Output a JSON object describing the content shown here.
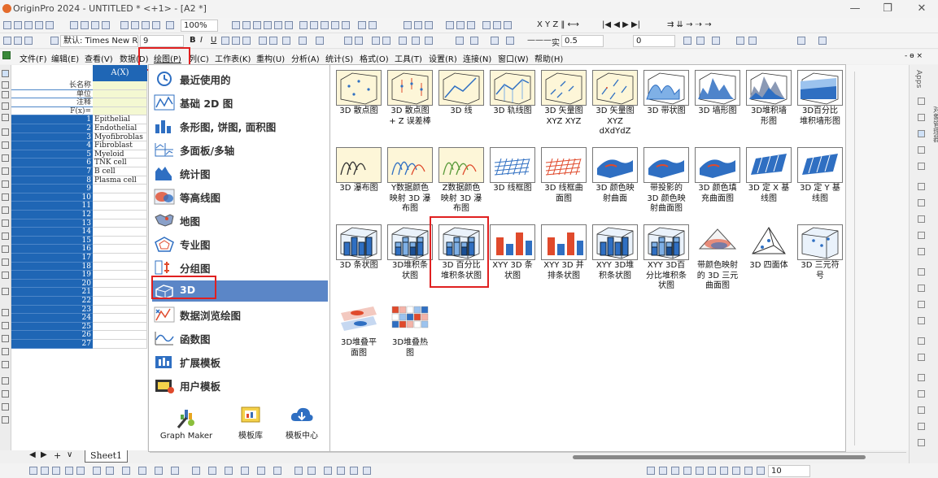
{
  "window": {
    "title": "OriginPro 2024 - UNTITLED * <+1> - [A2 *]",
    "minimize": "—",
    "restore": "❐",
    "close": "✕"
  },
  "toolbar": {
    "zoom": "100%",
    "font_name": "默认: Times New R",
    "font_size": "9",
    "bold": "B",
    "italic": "I",
    "underline": "U",
    "line_width_label": "实",
    "line_width": "0.5",
    "value2": "0",
    "pattern_value": "10"
  },
  "menubar": {
    "items": [
      "文件(F)",
      "编辑(E)",
      "查看(V)",
      "数据(D)",
      "绘图(P)",
      "列(C)",
      "工作表(K)",
      "重构(U)",
      "分析(A)",
      "统计(S)",
      "格式(O)",
      "工具(T)",
      "设置(R)",
      "连接(N)",
      "窗口(W)",
      "帮助(H)"
    ],
    "highlighted": "绘图(P)"
  },
  "sheet": {
    "column_header": "A(X)",
    "meta_rows": [
      "长名称",
      "单位",
      "注释",
      "F(x)="
    ],
    "rows": [
      {
        "n": "1",
        "v": "Epithelial"
      },
      {
        "n": "2",
        "v": "Endothelial"
      },
      {
        "n": "3",
        "v": "Myofibroblas"
      },
      {
        "n": "4",
        "v": "Fibroblast"
      },
      {
        "n": "5",
        "v": "Myeloid"
      },
      {
        "n": "6",
        "v": "TNK cell"
      },
      {
        "n": "7",
        "v": "B cell"
      },
      {
        "n": "8",
        "v": "Plasma cell"
      },
      {
        "n": "9",
        "v": ""
      },
      {
        "n": "10",
        "v": ""
      },
      {
        "n": "11",
        "v": ""
      },
      {
        "n": "12",
        "v": ""
      },
      {
        "n": "13",
        "v": ""
      },
      {
        "n": "14",
        "v": ""
      },
      {
        "n": "15",
        "v": ""
      },
      {
        "n": "16",
        "v": ""
      },
      {
        "n": "17",
        "v": ""
      },
      {
        "n": "18",
        "v": ""
      },
      {
        "n": "19",
        "v": ""
      },
      {
        "n": "20",
        "v": ""
      },
      {
        "n": "21",
        "v": ""
      },
      {
        "n": "22",
        "v": ""
      },
      {
        "n": "23",
        "v": ""
      },
      {
        "n": "24",
        "v": ""
      },
      {
        "n": "25",
        "v": ""
      },
      {
        "n": "26",
        "v": ""
      },
      {
        "n": "27",
        "v": ""
      }
    ],
    "tab_name": "Sheet1",
    "nav": [
      "◀",
      "▶",
      "+",
      "∨"
    ]
  },
  "plot_menu": {
    "categories": [
      {
        "label": "最近使用的",
        "icon": "recent-icon"
      },
      {
        "label": "基础 2D 图",
        "icon": "line-2d-icon"
      },
      {
        "label": "条形图, 饼图, 面积图",
        "icon": "bar-icon"
      },
      {
        "label": "多面板/多轴",
        "icon": "multipanel-icon"
      },
      {
        "label": "统计图",
        "icon": "histogram-icon"
      },
      {
        "label": "等高线图",
        "icon": "contour-icon"
      },
      {
        "label": "地图",
        "icon": "map-icon"
      },
      {
        "label": "专业图",
        "icon": "specialized-icon"
      },
      {
        "label": "分组图",
        "icon": "grouped-icon"
      },
      {
        "label": "3D",
        "icon": "cube-3d-icon"
      },
      {
        "label": "数据浏览绘图",
        "icon": "data-explore-icon"
      },
      {
        "label": "函数图",
        "icon": "function-icon"
      },
      {
        "label": "扩展模板",
        "icon": "extend-template-icon"
      },
      {
        "label": "用户模板",
        "icon": "user-template-icon"
      }
    ],
    "selected": "3D",
    "bottom_buttons": [
      "Graph Maker",
      "模板库",
      "模板中心"
    ]
  },
  "gallery": {
    "rows": [
      [
        "3D 散点图",
        "3D 散点图\n+ Z 误差棒",
        "3D 线",
        "3D 轨线图",
        "3D 矢量图\nXYZ XYZ",
        "3D 矢量图\nXYZ\ndXdYdZ",
        "3D 带状图",
        "3D 墙形图",
        "3D堆积墙\n形图",
        "3D百分比\n堆积墙形图"
      ],
      [
        "3D 瀑布图",
        "Y数据颜色\n映射 3D 瀑\n布图",
        "Z数据颜色\n映射 3D 瀑\n布图",
        "3D 线框图",
        "3D 线框曲\n面图",
        "3D 颜色映\n射曲面",
        "带投影的\n3D 颜色映\n射曲面图",
        "3D 颜色填\n充曲面图",
        "3D 定 X 基\n线图",
        "3D 定 Y 基\n线图"
      ],
      [
        "3D 条状图",
        "3D堆积条\n状图",
        "3D 百分比\n堆积条状图",
        "XYY 3D 条\n状图",
        "XYY 3D 并\n排条状图",
        "XYY 3D堆\n积条状图",
        "XYY 3D百\n分比堆积条\n状图",
        "带颜色映射\n的 3D 三元\n曲面图",
        "3D 四面体",
        "3D 三元符\n号"
      ],
      [
        "3D堆叠平\n面图",
        "3D堆叠热\n图"
      ]
    ],
    "highlighted": "3D 百分比\n堆积条状图"
  },
  "right_panel": {
    "tabs": [
      "Apps",
      "对象管理器"
    ]
  },
  "colors": {
    "accent": "#1f66b5",
    "selected_category": "#5b86c7",
    "highlight_box": "#e02020",
    "meta_fill": "#f4f8d2"
  }
}
